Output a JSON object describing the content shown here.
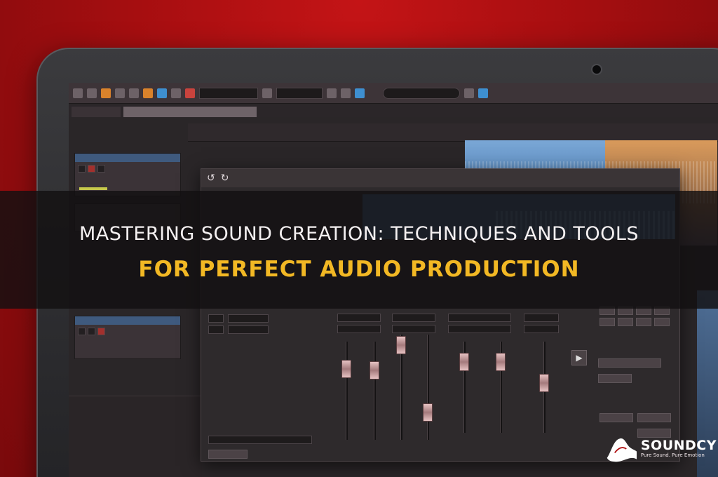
{
  "headline": {
    "line1": "MASTERING SOUND CREATION: TECHNIQUES AND TOOLS",
    "line2": "FOR PERFECT AUDIO PRODUCTION"
  },
  "brand": {
    "name": "SOUNDCY",
    "tagline": "Pure Sound. Pure Emotion"
  },
  "colors": {
    "background": "#b01012",
    "headline_line1": "#f4f0f1",
    "headline_line2": "#f2b824",
    "accent_region": "#4e7fb5"
  },
  "icons": [
    "undo-icon",
    "redo-icon",
    "play-icon",
    "search-icon",
    "record-icon"
  ]
}
